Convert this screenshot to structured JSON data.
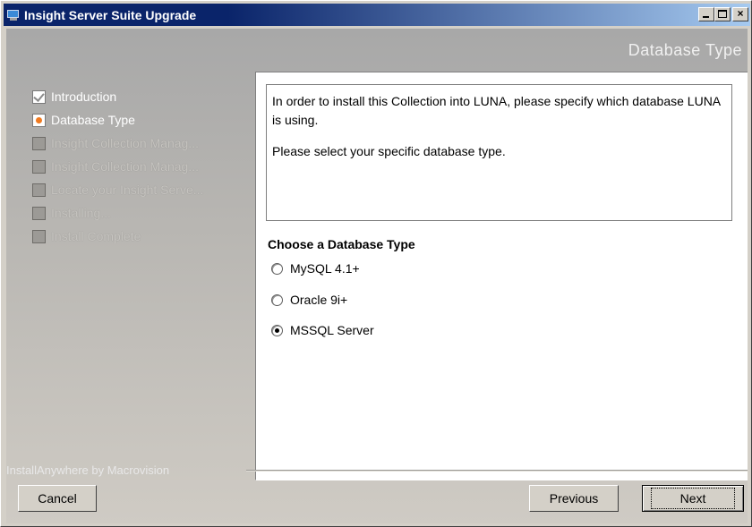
{
  "window": {
    "title": "Insight Server Suite Upgrade",
    "title_icon": "installer-icon",
    "controls": [
      "minimize-icon",
      "maximize-icon",
      "close-icon"
    ],
    "close_glyph": "×"
  },
  "header": {
    "section_title": "Database Type"
  },
  "steps": [
    {
      "label": "Introduction",
      "state": "done"
    },
    {
      "label": "Database Type",
      "state": "current"
    },
    {
      "label": "Insight Collection Manag...",
      "state": "pending"
    },
    {
      "label": "Insight Collection Manag...",
      "state": "pending"
    },
    {
      "label": "Locate your Insight Serve...",
      "state": "pending"
    },
    {
      "label": "Installing...",
      "state": "pending"
    },
    {
      "label": "Install Complete",
      "state": "pending"
    }
  ],
  "content": {
    "info_line1": "In order to install this Collection into LUNA, please specify which database LUNA is using.",
    "info_line2": "Please select your specific database type.",
    "choose_label": "Choose a Database Type",
    "options": [
      {
        "label": "MySQL 4.1+",
        "checked": false
      },
      {
        "label": "Oracle 9i+",
        "checked": false
      },
      {
        "label": "MSSQL Server",
        "checked": true
      }
    ]
  },
  "footer": {
    "brand": "InstallAnywhere by Macrovision",
    "cancel_label": "Cancel",
    "previous_label": "Previous",
    "next_label": "Next"
  },
  "colors": {
    "titlebar_start": "#0a246a",
    "titlebar_end": "#a6caf0",
    "current_step_accent": "#f07a20"
  }
}
